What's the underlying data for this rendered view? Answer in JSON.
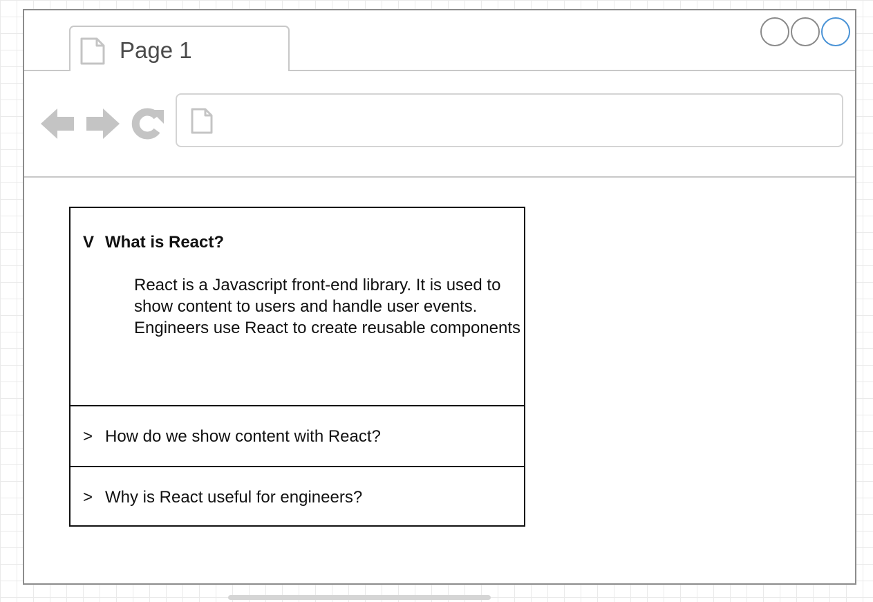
{
  "tab": {
    "label": "Page 1"
  },
  "window_controls": [
    "circle-icon",
    "circle-icon",
    "circle-icon"
  ],
  "nav": {
    "icons": [
      "arrow-left-icon",
      "arrow-right-icon",
      "refresh-icon",
      "page-icon"
    ],
    "address_value": ""
  },
  "accordion": {
    "items": [
      {
        "chevron": "V",
        "title": "What is React?",
        "expanded": true,
        "body": [
          "React is a Javascript front-end library. It is used to show content to users and handle user events.",
          "Engineers use React to create reusable components"
        ]
      },
      {
        "chevron": ">",
        "title": "How do we show content with React?",
        "expanded": false
      },
      {
        "chevron": ">",
        "title": "Why is React useful for engineers?",
        "expanded": false
      }
    ]
  },
  "colors": {
    "window_border": "#8c8c8c",
    "chrome_lines": "#c8c8c8",
    "nav_icon": "#c4c4c4",
    "accent_control": "#4a93d6",
    "accordion_border": "#111111"
  }
}
